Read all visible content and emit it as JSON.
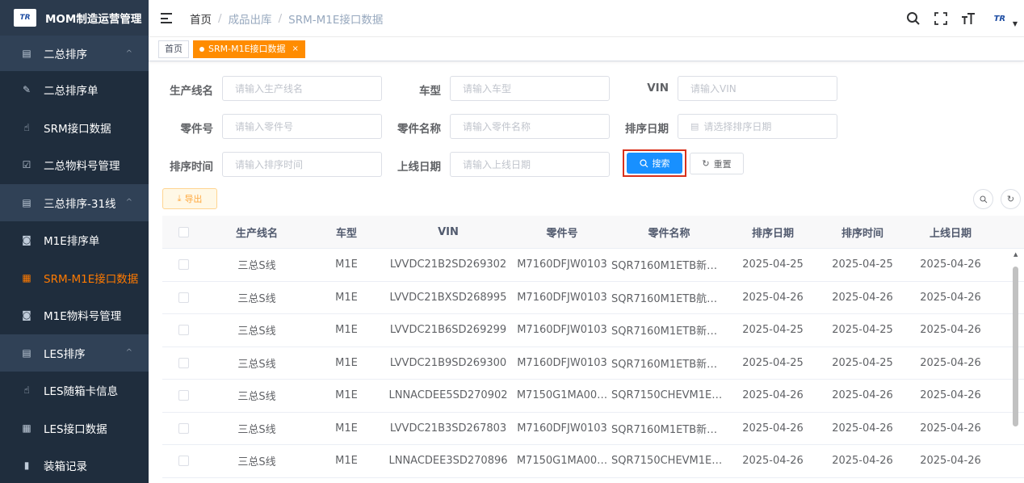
{
  "brand": {
    "logo_text": "TR",
    "title": "MOM制造运营管理"
  },
  "sidebar": {
    "items": [
      {
        "label": "二总排序",
        "icon": "list-icon",
        "caret": "^",
        "sub": false
      },
      {
        "label": "二总排序单",
        "icon": "edit-icon",
        "sub": true
      },
      {
        "label": "SRM接口数据",
        "icon": "hand-pointer-icon",
        "sub": true
      },
      {
        "label": "二总物料号管理",
        "icon": "checkbox-icon",
        "sub": true
      },
      {
        "label": "三总排序-31线",
        "icon": "list-icon",
        "caret": "^",
        "sub": false
      },
      {
        "label": "M1E排序单",
        "icon": "record-icon",
        "sub": true
      },
      {
        "label": "SRM-M1E接口数据",
        "icon": "table-icon",
        "sub": true,
        "active": true
      },
      {
        "label": "M1E物料号管理",
        "icon": "record-icon",
        "sub": true
      },
      {
        "label": "LES排序",
        "icon": "list-icon",
        "caret": "^",
        "sub": false
      },
      {
        "label": "LES随箱卡信息",
        "icon": "hand-pointer-icon",
        "sub": true
      },
      {
        "label": "LES接口数据",
        "icon": "table-icon",
        "sub": true
      },
      {
        "label": "装箱记录",
        "icon": "book-icon",
        "sub": true
      }
    ]
  },
  "header": {
    "breadcrumb": [
      "首页",
      "成品出库",
      "SRM-M1E接口数据"
    ],
    "icons": [
      "search-icon",
      "fullscreen-icon",
      "font-size-icon"
    ],
    "avatar_text": "TR"
  },
  "tags": [
    {
      "label": "首页",
      "active": false
    },
    {
      "label": "SRM-M1E接口数据",
      "active": true,
      "close": "×"
    }
  ],
  "form": {
    "line_name": {
      "label": "生产线名",
      "placeholder": "请输入生产线名"
    },
    "model": {
      "label": "车型",
      "placeholder": "请输入车型"
    },
    "vin": {
      "label": "VIN",
      "placeholder": "请输入VIN"
    },
    "part_no": {
      "label": "零件号",
      "placeholder": "请输入零件号"
    },
    "part_name": {
      "label": "零件名称",
      "placeholder": "请输入零件名称"
    },
    "sort_date": {
      "label": "排序日期",
      "placeholder": "请选择排序日期"
    },
    "sort_time": {
      "label": "排序时间",
      "placeholder": "请输入排序时间"
    },
    "online_date": {
      "label": "上线日期",
      "placeholder": "请输入上线日期"
    },
    "search_label": "搜索",
    "reset_label": "重置"
  },
  "toolbar": {
    "export_label": "导出"
  },
  "table": {
    "headers": [
      "生产线名",
      "车型",
      "VIN",
      "零件号",
      "零件名称",
      "排序日期",
      "排序时间",
      "上线日期"
    ],
    "rows": [
      [
        "三总S线",
        "M1E",
        "LVVDC21B2SD269302",
        "M7160DFJW0103",
        "SQR7160M1ETB新碳…",
        "2025-04-25",
        "2025-04-25",
        "2025-04-26"
      ],
      [
        "三总S线",
        "M1E",
        "LVVDC21BXSD268995",
        "M7160DFJW0103",
        "SQR7160M1ETB航空…",
        "2025-04-26",
        "2025-04-26",
        "2025-04-26"
      ],
      [
        "三总S线",
        "M1E",
        "LVVDC21B6SD269299",
        "M7160DFJW0103",
        "SQR7160M1ETB新碳…",
        "2025-04-25",
        "2025-04-25",
        "2025-04-26"
      ],
      [
        "三总S线",
        "M1E",
        "LVVDC21B9SD269300",
        "M7160DFJW0103",
        "SQR7160M1ETB新碳…",
        "2025-04-25",
        "2025-04-25",
        "2025-04-26"
      ],
      [
        "三总S线",
        "M1E",
        "LNNACDEE5SD270902",
        "M7150G1MA00…",
        "SQR7150CHEVM1E0…",
        "2025-04-26",
        "2025-04-26",
        "2025-04-26"
      ],
      [
        "三总S线",
        "M1E",
        "LVVDC21B3SD267803",
        "M7160DFJW0103",
        "SQR7160M1ETB新卡…",
        "2025-04-26",
        "2025-04-26",
        "2025-04-26"
      ],
      [
        "三总S线",
        "M1E",
        "LNNACDEE3SD270896",
        "M7150G1MA00…",
        "SQR7150CHEVM1E0…",
        "2025-04-26",
        "2025-04-26",
        "2025-04-26"
      ]
    ]
  },
  "colors": {
    "sidebar_bg": "#304156",
    "accent": "#ff8c00",
    "primary": "#1890ff",
    "highlight_border": "#d9301a"
  }
}
